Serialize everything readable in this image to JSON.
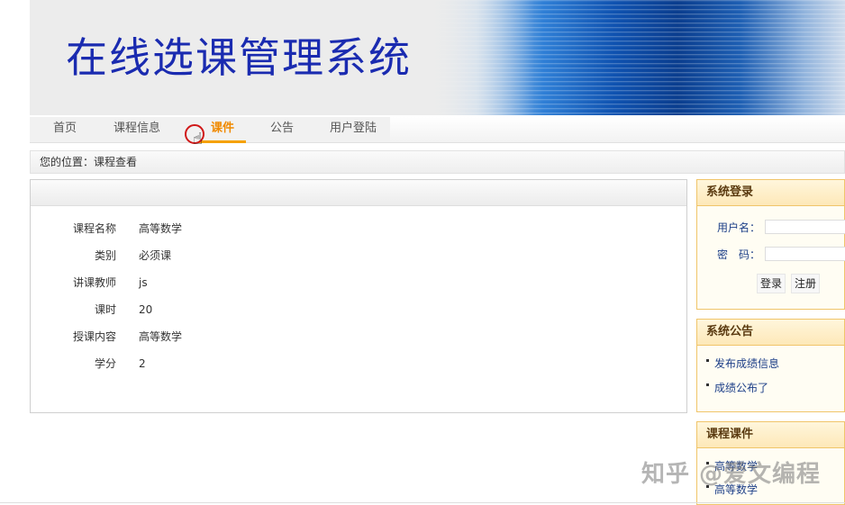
{
  "banner": {
    "title": "在线选课管理系统"
  },
  "nav": {
    "items": [
      {
        "label": "首页",
        "active": false
      },
      {
        "label": "课程信息",
        "active": false
      },
      {
        "label": "课件",
        "active": true
      },
      {
        "label": "公告",
        "active": false
      },
      {
        "label": "用户登陆",
        "active": false
      }
    ]
  },
  "breadcrumb": {
    "text": "您的位置：课程查看"
  },
  "course_detail": {
    "rows": [
      {
        "label": "课程名称",
        "value": "高等数学"
      },
      {
        "label": "类别",
        "value": "必须课"
      },
      {
        "label": "讲课教师",
        "value": "js"
      },
      {
        "label": "课时",
        "value": "20"
      },
      {
        "label": "授课内容",
        "value": "高等数学"
      },
      {
        "label": "学分",
        "value": "2"
      }
    ]
  },
  "login_box": {
    "title": "系统登录",
    "username_label": "用户名：",
    "password_label": "密　码：",
    "username_value": "",
    "password_value": "",
    "login_button": "登录",
    "register_button": "注册"
  },
  "notice_box": {
    "title": "系统公告",
    "items": [
      "发布成绩信息",
      "成绩公布了"
    ]
  },
  "courseware_box": {
    "title": "课程课件",
    "items": [
      "高等数学",
      "高等数学"
    ]
  },
  "watermark": {
    "text": "知乎 @爱文编程"
  },
  "colors": {
    "accent": "#f5a100",
    "title_blue": "#1a2bb0",
    "link_blue": "#1d3f88",
    "sidebar_border": "#f0c56a"
  }
}
